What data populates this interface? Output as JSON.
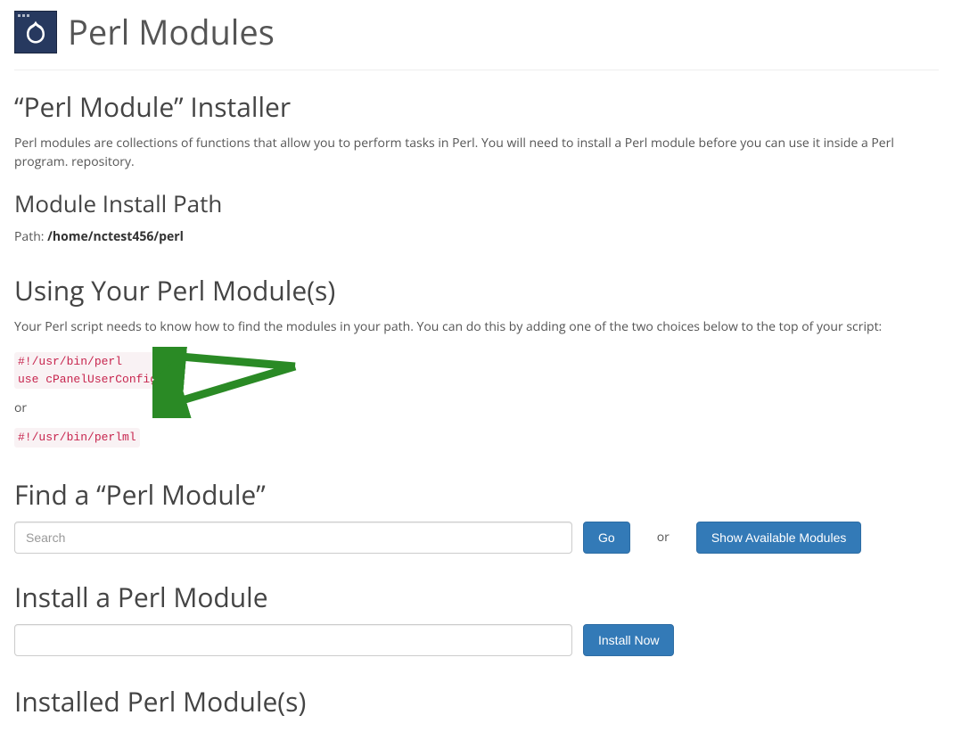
{
  "header": {
    "title": "Perl Modules"
  },
  "installer": {
    "heading": "“Perl Module” Installer",
    "description": "Perl modules are collections of functions that allow you to perform tasks in Perl. You will need to install a Perl module before you can use it inside a Perl program. repository."
  },
  "install_path": {
    "heading": "Module Install Path",
    "label": "Path: ",
    "value": "/home/nctest456/perl"
  },
  "using": {
    "heading": "Using Your Perl Module(s)",
    "description": "Your Perl script needs to know how to find the modules in your path. You can do this by adding one of the two choices below to the top of your script:",
    "code1": "#!/usr/bin/perl\nuse cPanelUserConfig;",
    "or_text": "or",
    "code2": "#!/usr/bin/perlml"
  },
  "find": {
    "heading": "Find a “Perl Module”",
    "placeholder": "Search",
    "go_label": "Go",
    "or_text": "or",
    "show_available_label": "Show Available Modules"
  },
  "install": {
    "heading": "Install a Perl Module",
    "install_now_label": "Install Now"
  },
  "installed": {
    "heading": "Installed Perl Module(s)"
  }
}
